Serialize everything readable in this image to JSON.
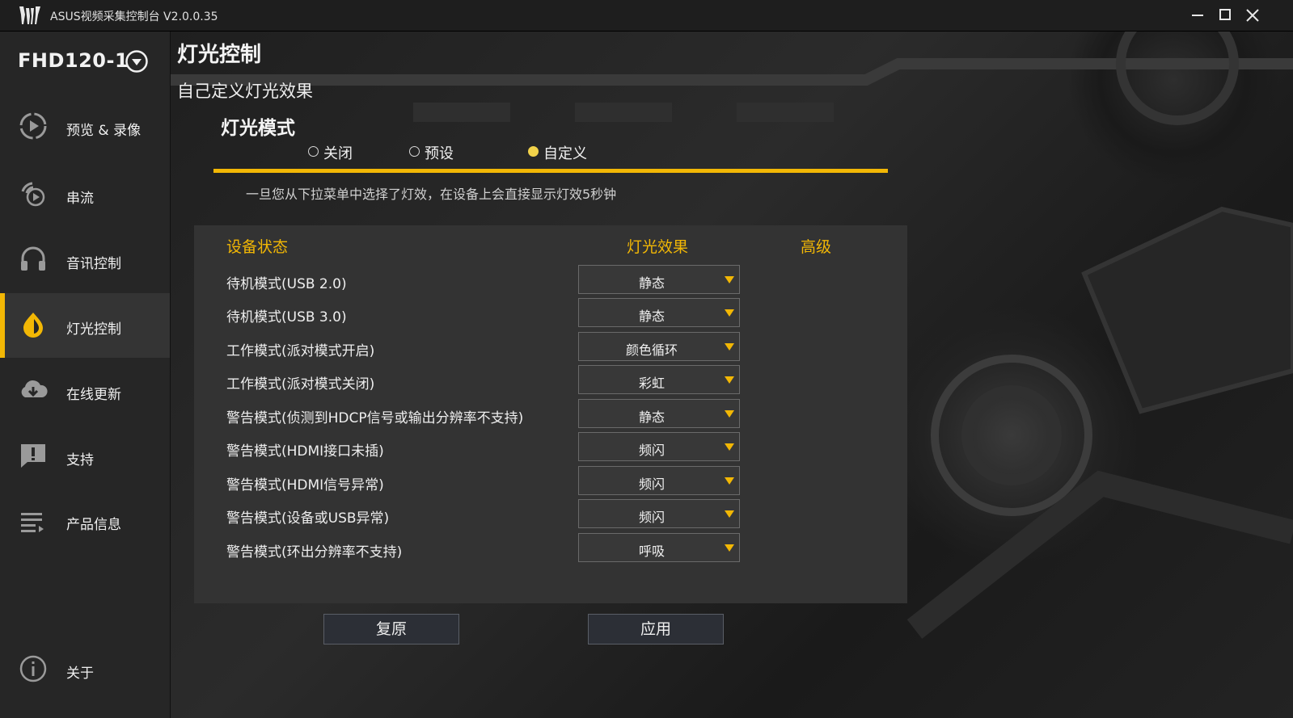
{
  "window": {
    "title": "ASUS视频采集控制台 V2.0.0.35",
    "minimize_icon": "minimize-icon",
    "maximize_icon": "maximize-icon",
    "close_icon": "close-icon"
  },
  "sidebar": {
    "device": "FHD120-1",
    "items": [
      {
        "label": "预览 & 录像",
        "icon": "play-icon"
      },
      {
        "label": "串流",
        "icon": "stream-icon"
      },
      {
        "label": "音讯控制",
        "icon": "headphones-icon"
      },
      {
        "label": "灯光控制",
        "icon": "light-icon"
      },
      {
        "label": "在线更新",
        "icon": "cloud-download-icon"
      },
      {
        "label": "支持",
        "icon": "alert-chat-icon"
      },
      {
        "label": "产品信息",
        "icon": "list-icon"
      },
      {
        "label": "关于",
        "icon": "info-icon"
      }
    ],
    "active_index": 3
  },
  "main": {
    "title": "灯光控制",
    "subtitle": "自己定义灯光效果",
    "mode_title": "灯光模式",
    "modes": [
      "关闭",
      "预设",
      "自定义"
    ],
    "selected_mode": "自定义",
    "hint": "一旦您从下拉菜单中选择了灯效，在设备上会直接显示灯效5秒钟",
    "table": {
      "headers": {
        "state": "设备状态",
        "effect": "灯光效果",
        "advanced": "高级"
      },
      "rows": [
        {
          "state": "待机模式(USB 2.0)",
          "effect": "静态"
        },
        {
          "state": "待机模式(USB 3.0)",
          "effect": "静态"
        },
        {
          "state": "工作模式(派对模式开启)",
          "effect": "颜色循环"
        },
        {
          "state": "工作模式(派对模式关闭)",
          "effect": "彩虹"
        },
        {
          "state": "警告模式(侦测到HDCP信号或输出分辨率不支持)",
          "effect": "静态"
        },
        {
          "state": "警告模式(HDMI接口未插)",
          "effect": "频闪"
        },
        {
          "state": "警告模式(HDMI信号异常)",
          "effect": "频闪"
        },
        {
          "state": "警告模式(设备或USB异常)",
          "effect": "频闪"
        },
        {
          "state": "警告模式(环出分辨率不支持)",
          "effect": "呼吸"
        }
      ]
    },
    "buttons": {
      "reset": "复原",
      "apply": "应用"
    }
  },
  "colors": {
    "accent": "#f2b705",
    "radio_checked": "#f2d24a",
    "sidebar_bg": "#262626",
    "panel_bg": "#343434"
  }
}
